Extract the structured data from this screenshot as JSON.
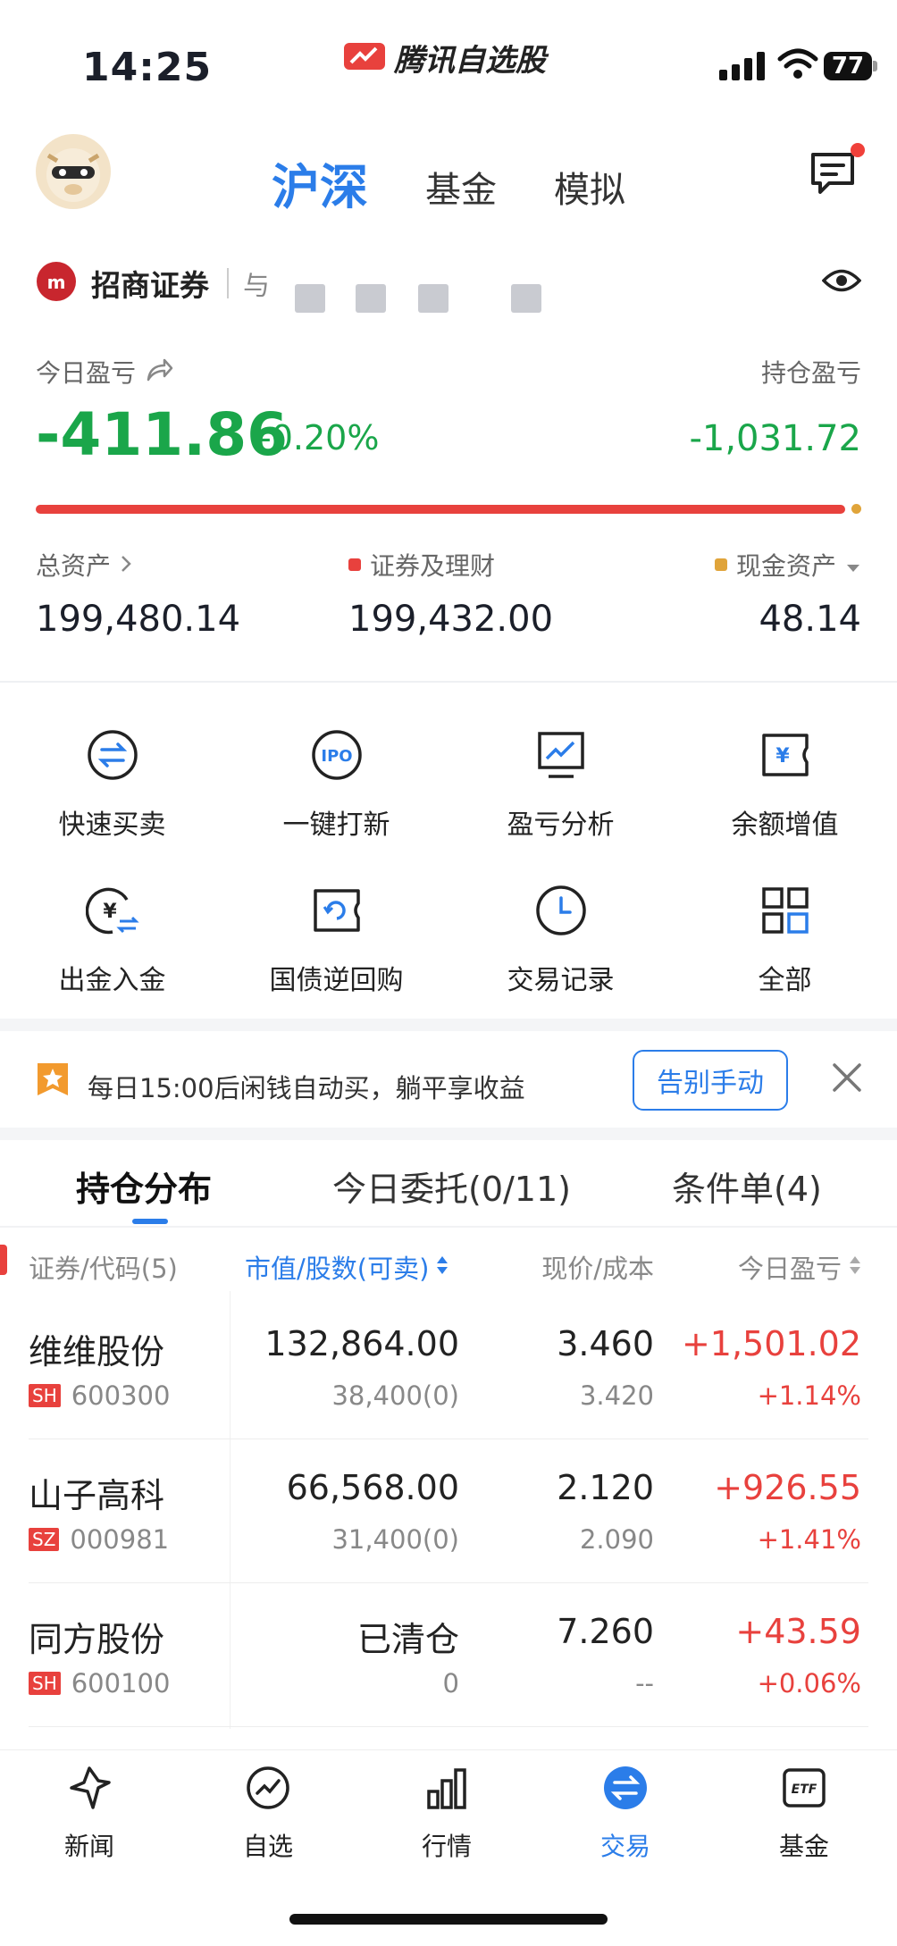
{
  "status": {
    "time": "14:25",
    "app_name": "腾讯自选股",
    "battery": "77"
  },
  "header": {
    "tabs": [
      {
        "label": "沪深"
      },
      {
        "label": "基金"
      },
      {
        "label": "模拟"
      }
    ]
  },
  "account": {
    "broker": "招商证券",
    "account_prefix": "与",
    "today_pnl_label": "今日盈亏",
    "today_pnl": "-411.86",
    "today_pnl_pct": "-0.20%",
    "holding_pnl_label": "持仓盈亏",
    "holding_pnl": "-1,031.72",
    "securities_ratio": 0.9997,
    "total_assets_label": "总资产",
    "total_assets": "199,480.14",
    "securities_label": "证券及理财",
    "securities_value": "199,432.00",
    "cash_label": "现金资产",
    "cash_value": "48.14",
    "colors": {
      "loss": "#1aa64a",
      "gain": "#e8413d",
      "cash": "#e0a43a",
      "accent": "#2b7de9"
    }
  },
  "shortcuts": [
    {
      "label": "快速买卖",
      "icon": "swap-circle-icon"
    },
    {
      "label": "一键打新",
      "icon": "ipo-icon"
    },
    {
      "label": "盈亏分析",
      "icon": "chart-monitor-icon"
    },
    {
      "label": "余额增值",
      "icon": "yen-ticket-icon"
    },
    {
      "label": "出金入金",
      "icon": "yen-transfer-icon"
    },
    {
      "label": "国债逆回购",
      "icon": "refresh-ticket-icon"
    },
    {
      "label": "交易记录",
      "icon": "clock-icon"
    },
    {
      "label": "全部",
      "icon": "grid-icon"
    }
  ],
  "banner": {
    "text": "每日15:00后闲钱自动买，躺平享收益",
    "button": "告别手动"
  },
  "position_tabs": [
    {
      "label": "持仓分布"
    },
    {
      "label": "今日委托(0/11)"
    },
    {
      "label": "条件单(4)"
    }
  ],
  "table": {
    "headers": [
      "证券/代码(5)",
      "市值/股数(可卖)",
      "现价/成本",
      "今日盈亏"
    ],
    "rows": [
      {
        "name": "维维股份",
        "market": "SH",
        "code": "600300",
        "value": "132,864.00",
        "shares": "38,400(0)",
        "price": "3.460",
        "cost": "3.420",
        "pnl": "+1,501.02",
        "pnl_pct": "+1.14%"
      },
      {
        "name": "山子高科",
        "market": "SZ",
        "code": "000981",
        "value": "66,568.00",
        "shares": "31,400(0)",
        "price": "2.120",
        "cost": "2.090",
        "pnl": "+926.55",
        "pnl_pct": "+1.41%"
      },
      {
        "name": "同方股份",
        "market": "SH",
        "code": "600100",
        "value": "已清仓",
        "shares": "0",
        "price": "7.260",
        "cost": "--",
        "pnl": "+43.59",
        "pnl_pct": "+0.06%"
      }
    ]
  },
  "bottom_nav": [
    {
      "label": "新闻",
      "icon": "news-icon"
    },
    {
      "label": "自选",
      "icon": "watchlist-icon"
    },
    {
      "label": "行情",
      "icon": "market-icon"
    },
    {
      "label": "交易",
      "icon": "trade-icon"
    },
    {
      "label": "基金",
      "icon": "etf-icon"
    }
  ]
}
